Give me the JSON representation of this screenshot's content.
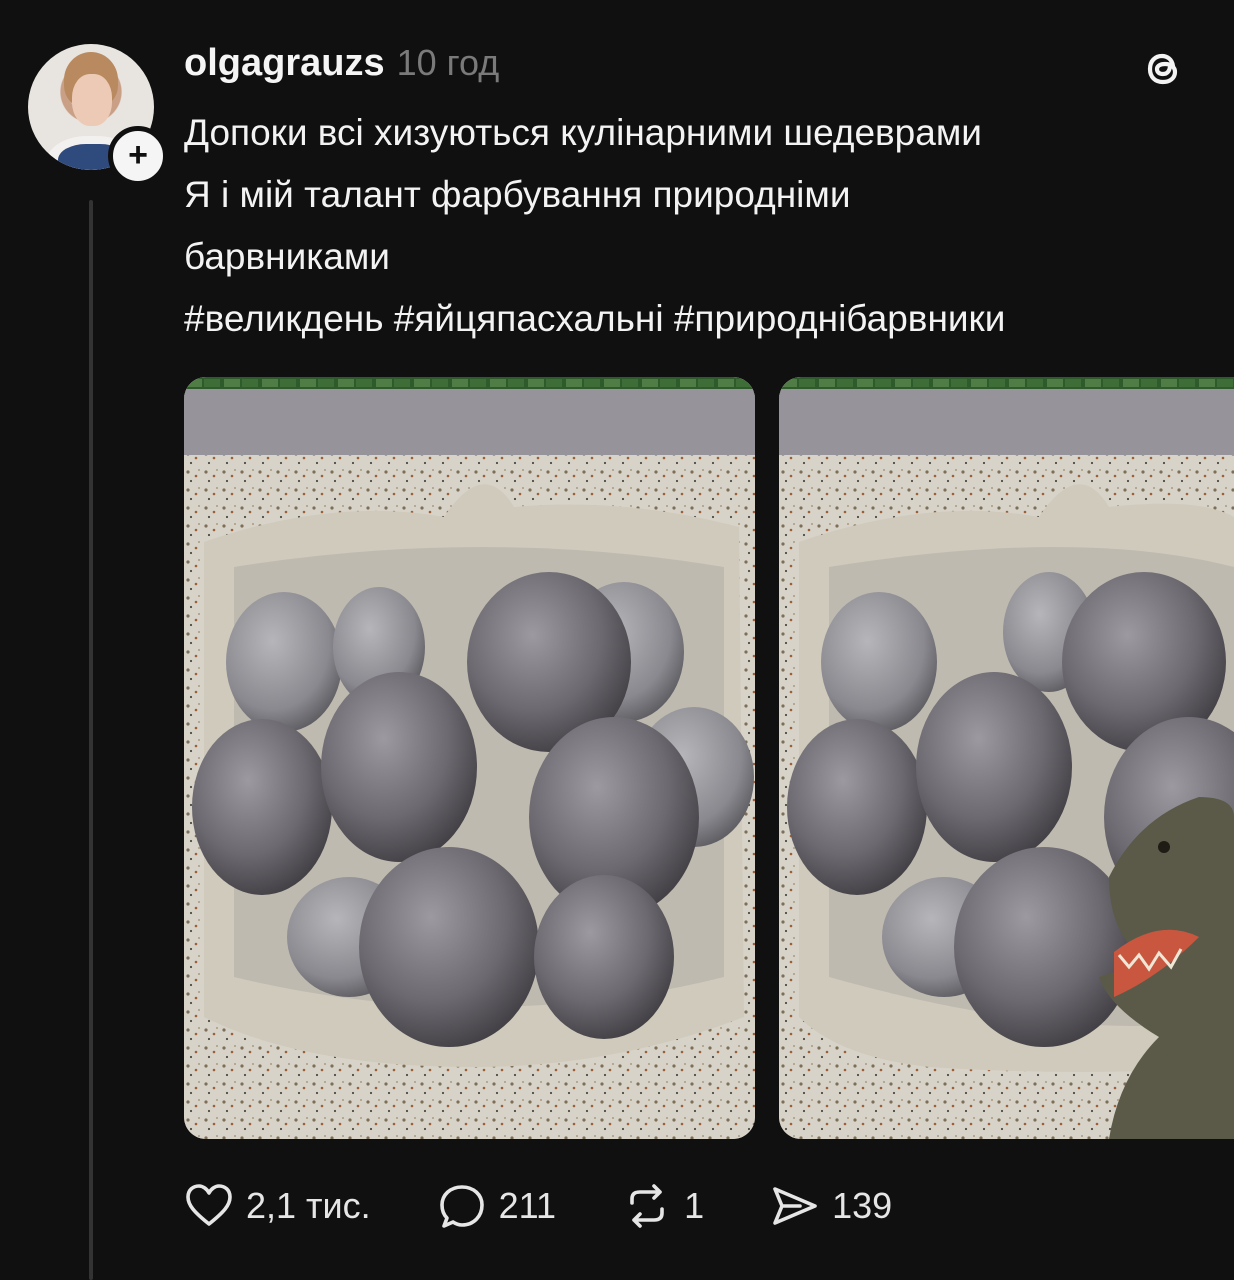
{
  "post": {
    "username": "olgagrauzs",
    "time": "10 год",
    "lines": [
      "Допоки всі хизуються кулінарними шедеврами",
      "Я і мій талант фарбування природніми",
      "барвниками"
    ],
    "hashtags": "#великдень #яйцяпасхальні #природнібарвники"
  },
  "icons": {
    "avatar": "avatar",
    "follow": "plus-icon",
    "brand": "threads-logo-icon",
    "like": "heart-icon",
    "comment": "comment-bubble-icon",
    "repost": "repost-icon",
    "share": "send-icon"
  },
  "actions": {
    "likes": "2,1 тис.",
    "comments": "211",
    "reposts": "1",
    "shares": "139"
  },
  "colors": {
    "background": "#101010",
    "text": "#f3f3f3",
    "muted": "#7a7a7a"
  }
}
